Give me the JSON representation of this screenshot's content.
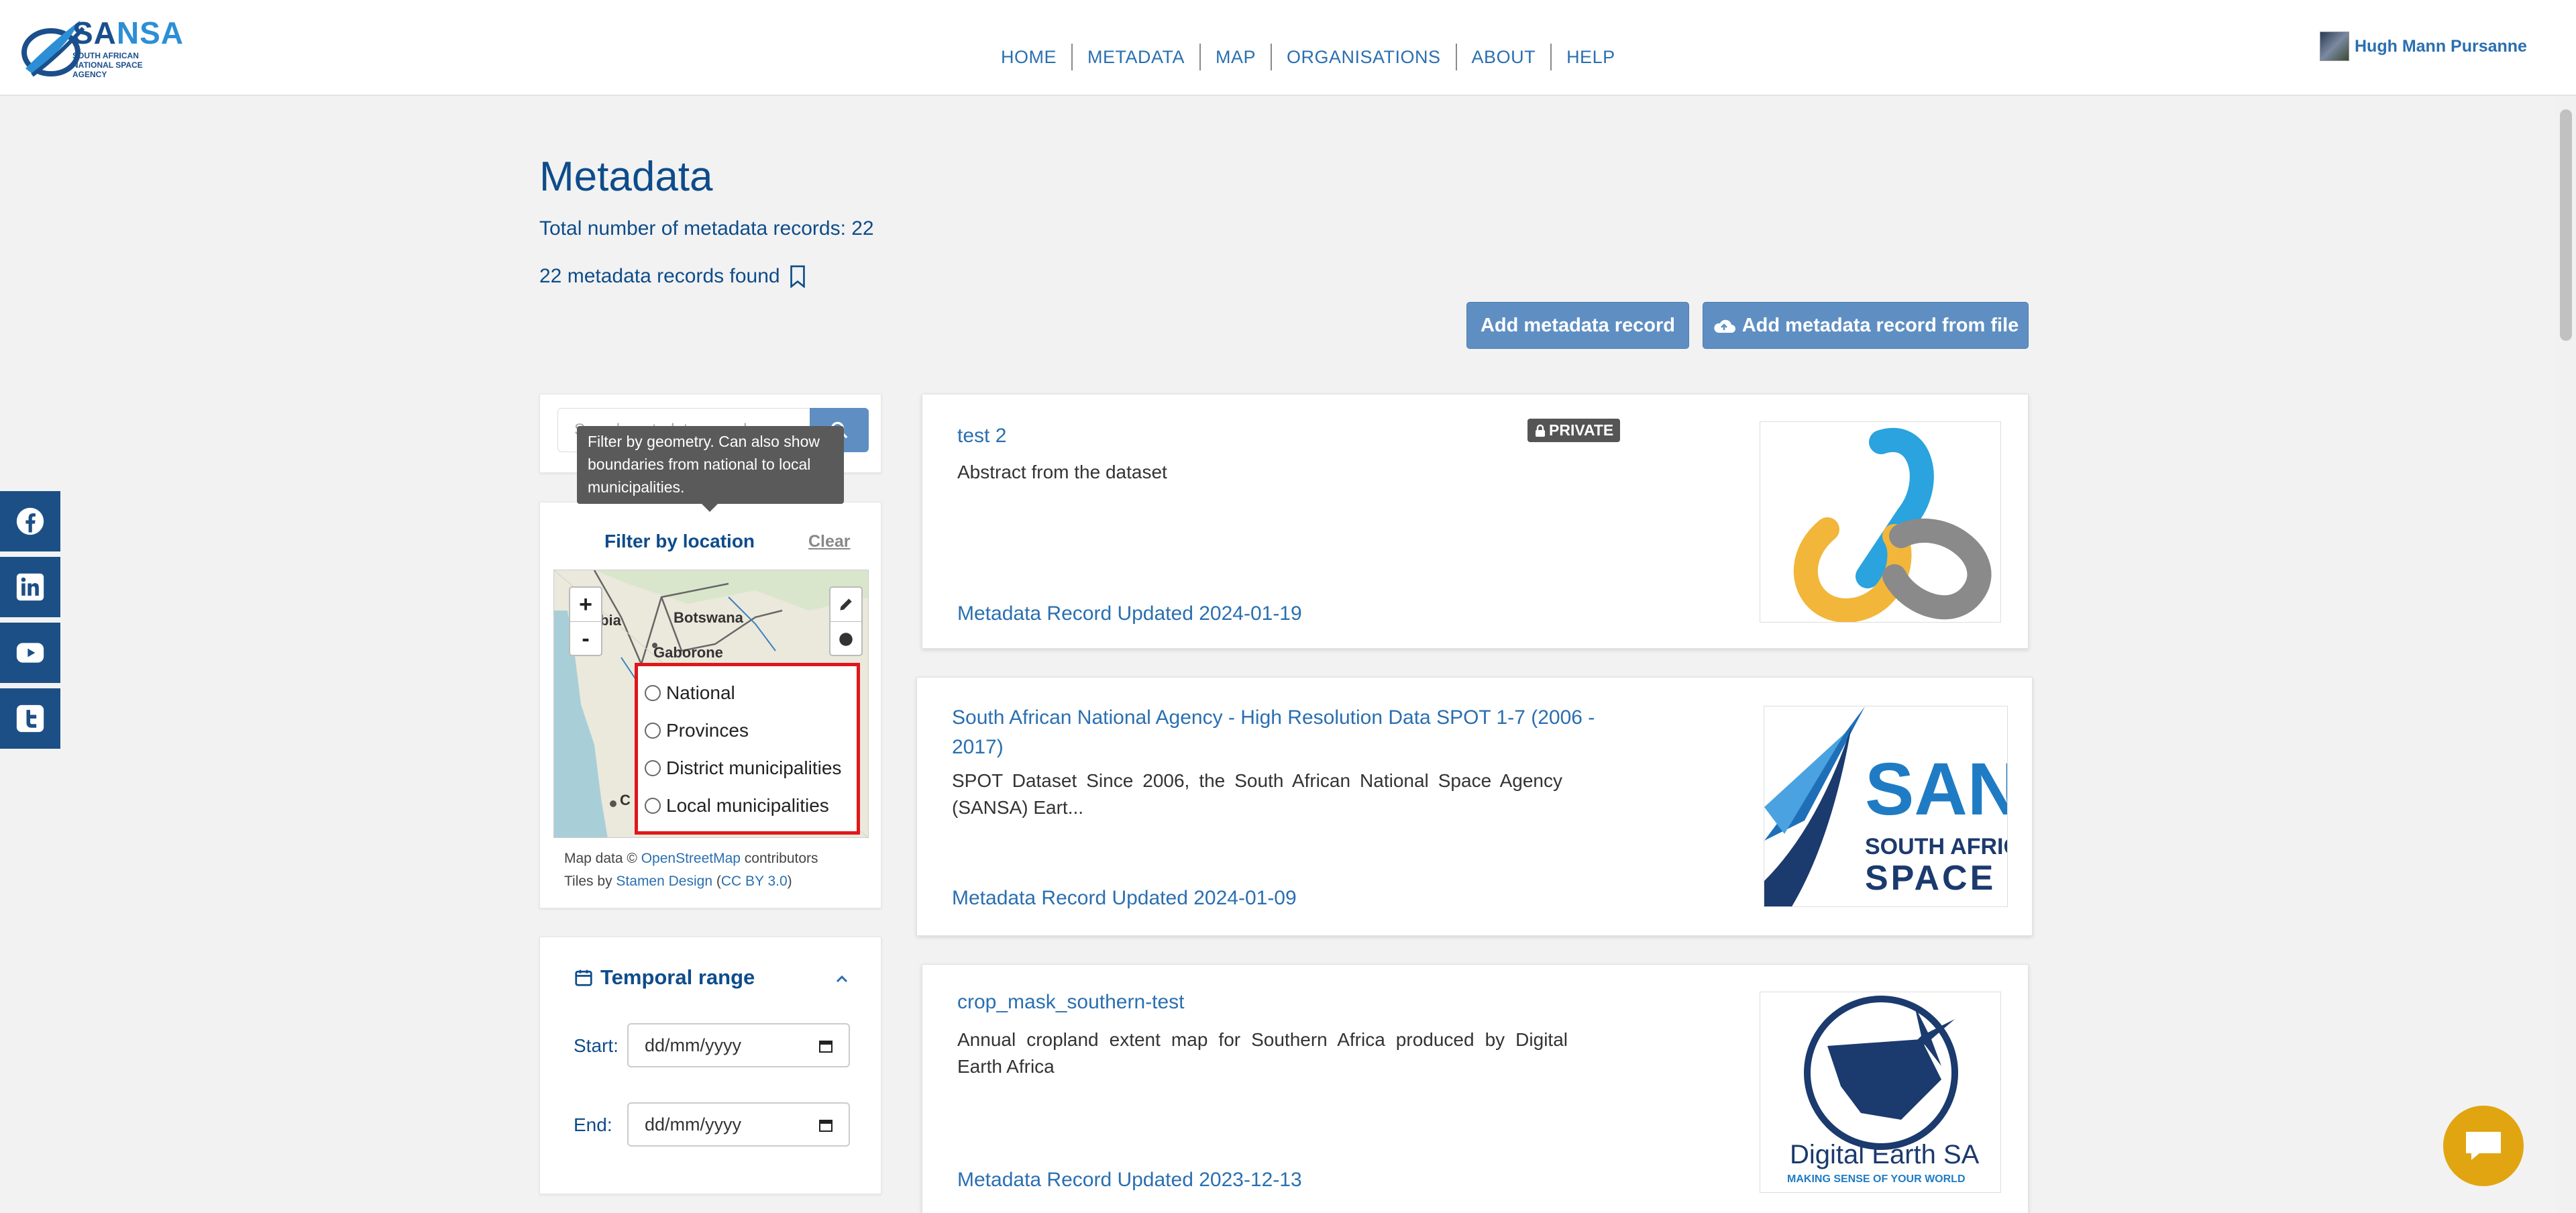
{
  "brand": {
    "logo_word_main": "SA",
    "logo_word_accent": "NSA",
    "logo_sub": "SOUTH AFRICAN NATIONAL SPACE AGENCY"
  },
  "nav": [
    "HOME",
    "METADATA",
    "MAP",
    "ORGANISATIONS",
    "ABOUT",
    "HELP"
  ],
  "user": {
    "name": "Hugh Mann Pursanne"
  },
  "social": [
    "facebook-icon",
    "linkedin-icon",
    "youtube-icon",
    "twitter-icon"
  ],
  "page": {
    "title": "Metadata",
    "total": "Total number of metadata records: 22",
    "found": "22 metadata records found"
  },
  "actions": {
    "add": "Add metadata record",
    "add_from_file": "Add metadata record from file"
  },
  "search": {
    "placeholder": "Search metadata records"
  },
  "tooltip": "Filter by geometry. Can also show boundaries from national to local municipalities.",
  "location_filter": {
    "title": "Filter by location",
    "clear": "Clear",
    "zoom_in": "+",
    "zoom_out": "-",
    "map_labels": {
      "botswana": "Botswana",
      "gaborone": "Gaborone",
      "namibia": "ibia",
      "cape": "C"
    },
    "options": [
      "National",
      "Provinces",
      "District municipalities",
      "Local municipalities"
    ],
    "attribution_prefix": "Map data © ",
    "attribution_osm": "OpenStreetMap",
    "attribution_contrib": " contributors",
    "attribution_tiles": "Tiles by ",
    "attribution_stamen": "Stamen Design",
    "attribution_lic_open": " (",
    "attribution_cc": "CC BY 3.0",
    "attribution_lic_close": ")"
  },
  "temporal": {
    "title": "Temporal range",
    "start_label": "Start:",
    "end_label": "End:",
    "start_value": "dd/mm/yyyy",
    "end_value": "dd/mm/yyyy"
  },
  "records": [
    {
      "title": "test 2",
      "badge": "PRIVATE",
      "abstract": "Abstract from the dataset",
      "updated": "Metadata Record Updated 2024-01-19"
    },
    {
      "title": "South African National Agency - High Resolution Data SPOT 1-7 (2006 - 2017)",
      "abstract": "SPOT Dataset Since 2006, the South African National Space Agency (SANSA) Eart...",
      "updated": "Metadata Record Updated 2024-01-09",
      "thumb_text_1": "SAN",
      "thumb_text_2": "SOUTH AFRICA",
      "thumb_text_3": "SPACE A"
    },
    {
      "title": "crop_mask_southern-test",
      "abstract": "Annual cropland extent map for Southern Africa produced by Digital Earth Africa",
      "updated": "Metadata Record Updated 2023-12-13",
      "thumb_text_1": "Digital Earth SA",
      "thumb_text_2": "MAKING SENSE OF YOUR WORLD"
    }
  ],
  "colors": {
    "primary": "#0e4c8a",
    "link": "#2a6fb0",
    "button": "#5f8fc2",
    "highlight": "#e0171a",
    "chat": "#e0a510"
  }
}
